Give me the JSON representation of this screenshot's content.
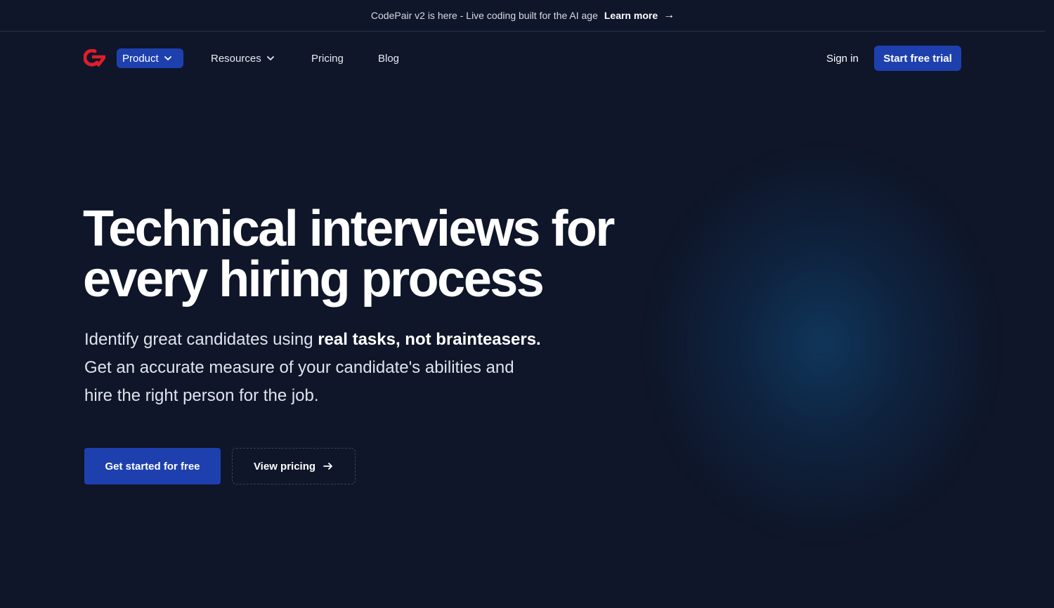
{
  "announcement": {
    "message": "CodePair v2 is here - Live coding built for the AI age",
    "link_label": "Learn more",
    "link_icon": "arrow-right-icon"
  },
  "nav": {
    "logo_icon": "codepair-logo-icon",
    "items": [
      {
        "label": "Product",
        "has_dropdown": true,
        "active": true
      },
      {
        "label": "Resources",
        "has_dropdown": true,
        "active": false
      },
      {
        "label": "Pricing",
        "has_dropdown": false,
        "active": false
      },
      {
        "label": "Blog",
        "has_dropdown": false,
        "active": false
      }
    ],
    "signin_label": "Sign in",
    "trial_label": "Start free trial"
  },
  "hero": {
    "title_line1": "Technical interviews for",
    "title_line2": "every hiring process",
    "sub_part1": "Identify great candidates using ",
    "sub_bold": "real tasks, not brainteasers.",
    "sub_part2": " Get an accurate measure of your candidate's abilities and hire the right person for the job.",
    "cta_primary": "Get started for free",
    "cta_secondary": "View pricing",
    "cta_secondary_icon": "arrow-right-icon"
  },
  "colors": {
    "background": "#0f1629",
    "accent": "#1e40af",
    "logo": "#e11d2a"
  }
}
